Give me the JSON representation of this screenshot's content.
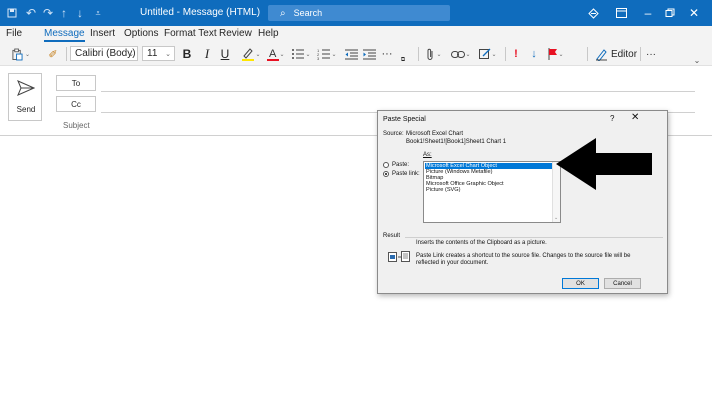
{
  "window": {
    "title": "Untitled  -  Message (HTML)",
    "search_placeholder": "Search"
  },
  "menu": [
    "File",
    "Message",
    "Insert",
    "Options",
    "Format Text",
    "Review",
    "Help"
  ],
  "ribbon": {
    "font_name": "Calibri (Body)",
    "font_size": "11",
    "bold": "B",
    "italic": "I",
    "underline": "U",
    "editor_label": "Editor",
    "more": "···"
  },
  "compose": {
    "send_label": "Send",
    "to_label": "To",
    "cc_label": "Cc",
    "subject_label": "Subject"
  },
  "dialog": {
    "title": "Paste Special",
    "help": "?",
    "close": "✕",
    "source_label": "Source:",
    "source_value": "Microsoft Excel Chart",
    "source_path": "Book1!Sheet1![Book1]Sheet1 Chart 1",
    "as_label": "As:",
    "paste_label": "Paste:",
    "paste_link_label": "Paste link:",
    "selected_option": "paste_link",
    "options": [
      "Microsoft Excel Chart Object",
      "Picture (Windows Metafile)",
      "Bitmap",
      "Microsoft Office Graphic Object",
      "Picture (SVG)"
    ],
    "selected_index": 0,
    "result_label": "Result",
    "result_text_1": "Inserts the contents of the Clipboard as a picture.",
    "result_text_2a": "Paste Link creates a shortcut to the source file. Changes to the source file will be",
    "result_text_2b": "reflected in your document.",
    "ok_label": "OK",
    "cancel_label": "Cancel"
  },
  "colors": {
    "titlebar": "#0f6cbd",
    "accent": "#0f6cbd",
    "flag": "#e81123",
    "importance_high": "#e81123",
    "importance_low": "#0f6cbd",
    "selection": "#0078d7"
  }
}
